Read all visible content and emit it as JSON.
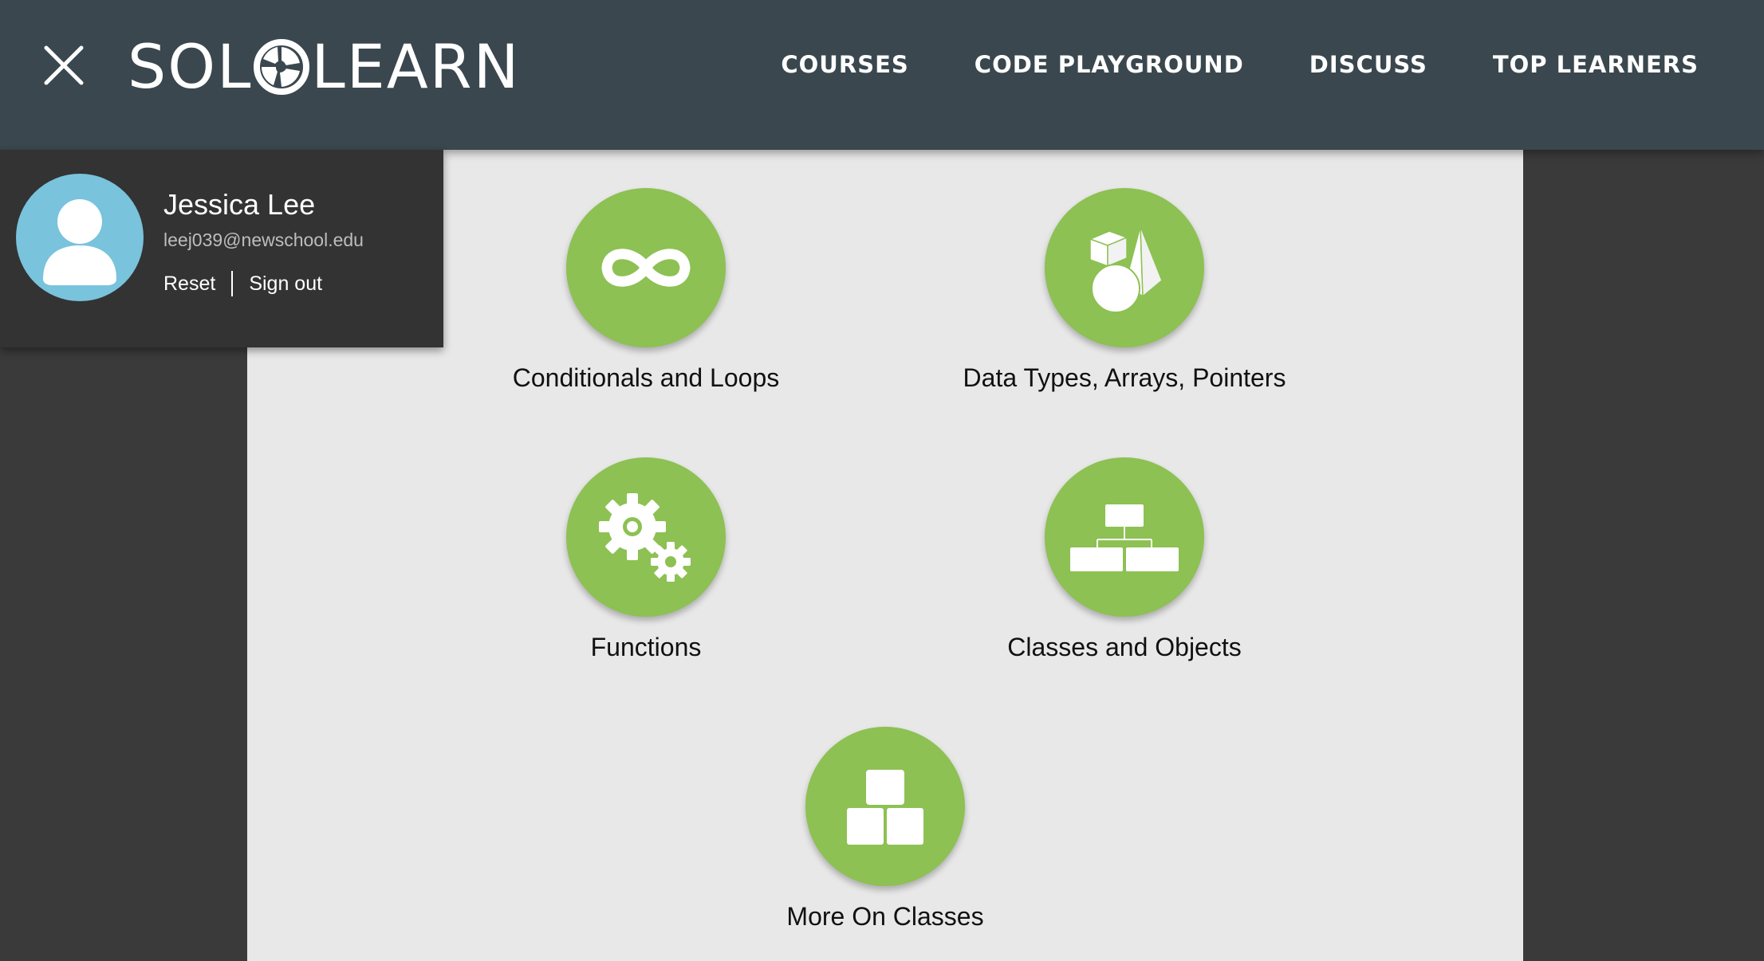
{
  "header": {
    "logo_text_left": "SOL",
    "logo_text_right": "LEARN",
    "nav": [
      {
        "label": "COURSES"
      },
      {
        "label": "CODE PLAYGROUND"
      },
      {
        "label": "DISCUSS"
      },
      {
        "label": "TOP LEARNERS"
      }
    ]
  },
  "profile": {
    "name": "Jessica Lee",
    "email": "leej039@newschool.edu",
    "reset_label": "Reset",
    "signout_label": "Sign out"
  },
  "modules": [
    {
      "label": "Conditionals and Loops",
      "icon": "infinity-icon"
    },
    {
      "label": "Data Types, Arrays, Pointers",
      "icon": "shapes-icon"
    },
    {
      "label": "Functions",
      "icon": "gears-icon"
    },
    {
      "label": "Classes and Objects",
      "icon": "hierarchy-icon"
    },
    {
      "label": "More On Classes",
      "icon": "blocks-icon"
    }
  ],
  "colors": {
    "header_bg": "#3a474e",
    "module_green": "#8dc153",
    "avatar_blue": "#79c3dc",
    "content_bg": "#e8e8e8",
    "page_bg": "#3a3a3a"
  }
}
